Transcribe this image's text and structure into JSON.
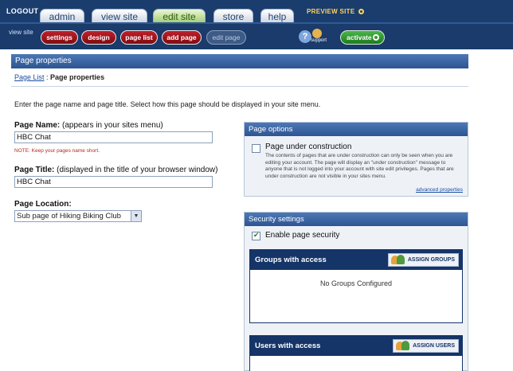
{
  "topnav": {
    "logout": "LOGOUT",
    "tabs": [
      {
        "label": "admin"
      },
      {
        "label": "view site"
      },
      {
        "label": "edit site"
      },
      {
        "label": "store"
      },
      {
        "label": "help"
      }
    ],
    "preview": "PREVIEW SITE"
  },
  "subnav": {
    "view_site": "view site",
    "buttons": [
      {
        "label": "settings"
      },
      {
        "label": "design"
      },
      {
        "label": "page list"
      },
      {
        "label": "add page"
      },
      {
        "label": "edit page"
      }
    ],
    "support": "support",
    "activate": "activate"
  },
  "page": {
    "header": "Page properties",
    "breadcrumb_link": "Page List",
    "breadcrumb_sep": " : ",
    "breadcrumb_current": "Page properties",
    "intro": "Enter the page name and page title. Select how this page should be displayed in your site menu."
  },
  "form": {
    "name_label": "Page Name:",
    "name_hint": "(appears in your sites menu)",
    "name_value": "HBC Chat",
    "name_note": "NOTE: Keep your pages name short.",
    "title_label": "Page Title:",
    "title_hint": "(displayed in the title of your browser window)",
    "title_value": "HBC Chat",
    "location_label": "Page Location:",
    "location_value": "Sub page of Hiking Biking Club"
  },
  "options": {
    "header": "Page options",
    "under_construction": "Page under construction",
    "under_construction_checked": false,
    "description": "The contents of pages that are under construction can only be seen when you are editing your account. The page will display an \"under construction\" message to anyone that is not logged into your account with site edit privileges. Pages that are under construction are not visible in your sites menu.",
    "advanced_link": "advanced properties"
  },
  "security": {
    "header": "Security settings",
    "enable_label": "Enable page security",
    "enable_checked": true,
    "groups_header": "Groups with access",
    "assign_groups": "ASSIGN GROUPS",
    "groups_empty": "No Groups Configured",
    "users_header": "Users with access",
    "assign_users": "ASSIGN USERS"
  }
}
